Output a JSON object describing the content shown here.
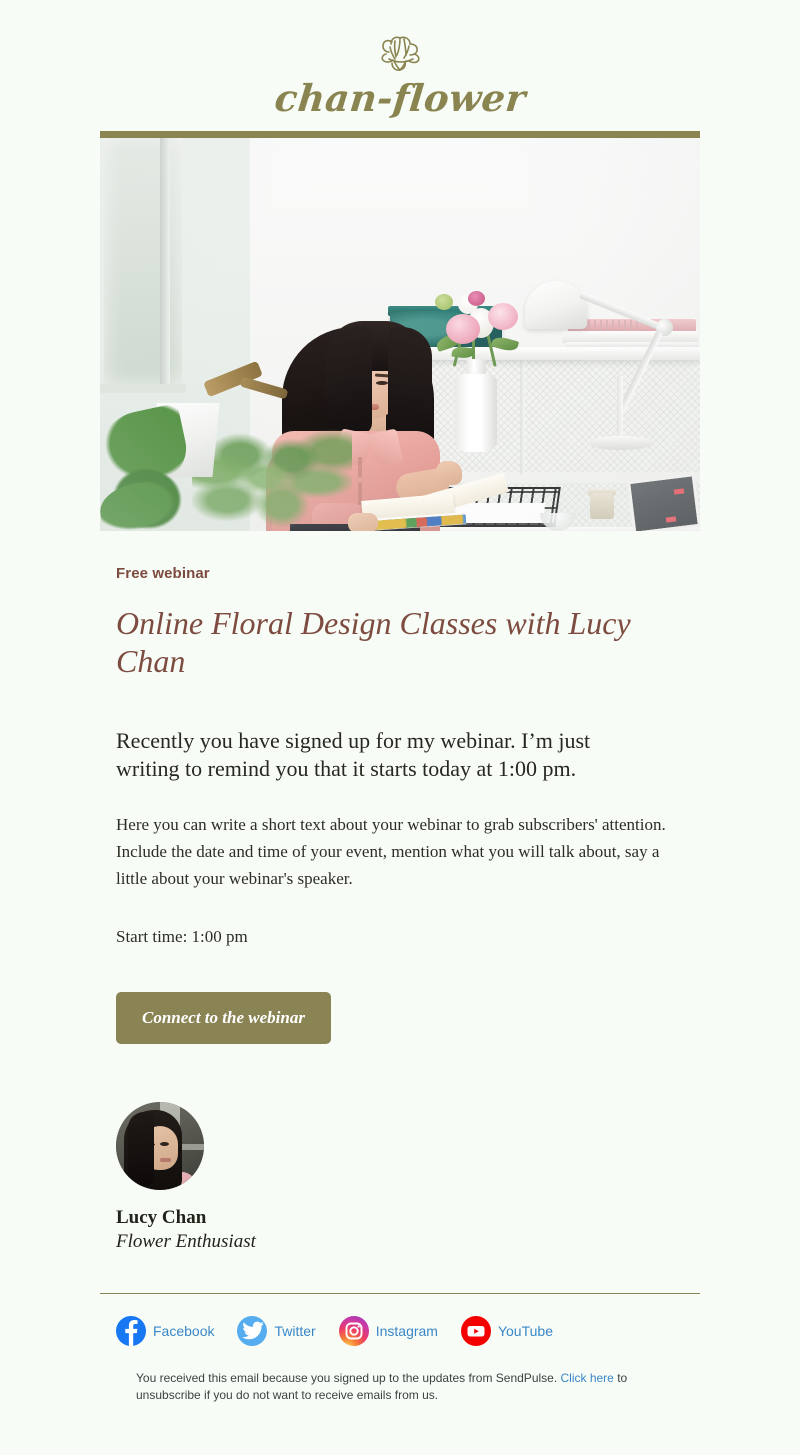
{
  "brand": {
    "name": "chan-flower",
    "logo_icon": "flower-outline-icon",
    "accent_olive": "#8a8455",
    "accent_brown": "#7d4b3f",
    "page_background": "#f7fcf7"
  },
  "hero": {
    "alt": "Woman in pink shirt reading a book beside shelves with plants and flowers",
    "topbar_color": "#8a8455"
  },
  "article": {
    "eyebrow": "Free webinar",
    "headline": "Online Floral Design Classes with Lucy Chan",
    "lede": "Recently you have signed up for my webinar. I’m just writing to remind you that it starts today at 1:00 pm.",
    "body": "Here you can write a short text about your webinar to grab subscribers' attention. Include the date and time of your event, mention what you will talk about, say a little about your webinar's speaker.",
    "start_time": "Start time: 1:00 pm",
    "cta_label": "Connect to the webinar"
  },
  "author": {
    "avatar_alt": "Portrait of Lucy Chan",
    "name": "Lucy Chan",
    "role": "Flower Enthusiast"
  },
  "footer": {
    "social": [
      {
        "label": "Facebook",
        "icon": "facebook-icon",
        "color": "#1877f2"
      },
      {
        "label": "Twitter",
        "icon": "twitter-icon",
        "color": "#55acee"
      },
      {
        "label": "Instagram",
        "icon": "instagram-icon",
        "color": "#c93aa8"
      },
      {
        "label": "YouTube",
        "icon": "youtube-icon",
        "color": "#f40000"
      }
    ],
    "legal_before": "You received this email because you signed up to the updates from SendPulse. ",
    "legal_link": "Click here",
    "legal_after": " to unsubscribe if you do not want to receive emails from us.",
    "link_color": "#3a87c8"
  }
}
